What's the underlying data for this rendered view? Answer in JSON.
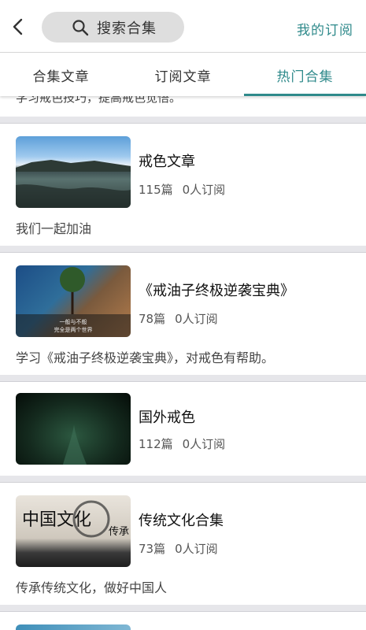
{
  "header": {
    "search_placeholder": "搜索合集",
    "subscriptions_link": "我的订阅"
  },
  "tabs": [
    {
      "label": "合集文章",
      "active": false
    },
    {
      "label": "订阅文章",
      "active": false
    },
    {
      "label": "热门合集",
      "active": true
    }
  ],
  "accent_color": "#2f8a8b",
  "feed": {
    "partial_text": "学习戒色技巧，提高戒色觉悟。",
    "items": [
      {
        "title": "戒色文章",
        "articles": "115篇",
        "subscribers": "0人订阅",
        "description": "我们一起加油",
        "thumb_icon": "lake-landscape-image"
      },
      {
        "title": "《戒油子终极逆袭宝典》",
        "articles": "78篇",
        "subscribers": "0人订阅",
        "description": "学习《戒油子终极逆袭宝典》，对戒色有帮助。",
        "thumb_icon": "tree-on-cliff-image",
        "thumb_text": [
          "一般与不般",
          "完全是两个世界"
        ]
      },
      {
        "title": "国外戒色",
        "articles": "112篇",
        "subscribers": "0人订阅",
        "description": "",
        "thumb_icon": "dark-forest-path-image"
      },
      {
        "title": "传统文化合集",
        "articles": "73篇",
        "subscribers": "0人订阅",
        "description": "传承传统文化，做好中国人",
        "thumb_icon": "chinese-calligraphy-image",
        "thumb_text": [
          "中国文化",
          "传承"
        ]
      }
    ]
  }
}
